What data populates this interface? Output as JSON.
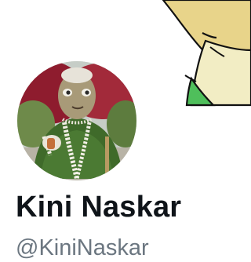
{
  "profile": {
    "display_name": "Kini Naskar",
    "handle": "@KiniNaskar",
    "avatar_icon": "figurine-photo",
    "banner_icon": "cartoon-banner-art"
  },
  "colors": {
    "name_text": "#0f1419",
    "handle_text": "#6b7680",
    "banner_yellow": "#e8d48a",
    "banner_cream": "#f2edc4",
    "banner_green": "#4fbf5b"
  }
}
